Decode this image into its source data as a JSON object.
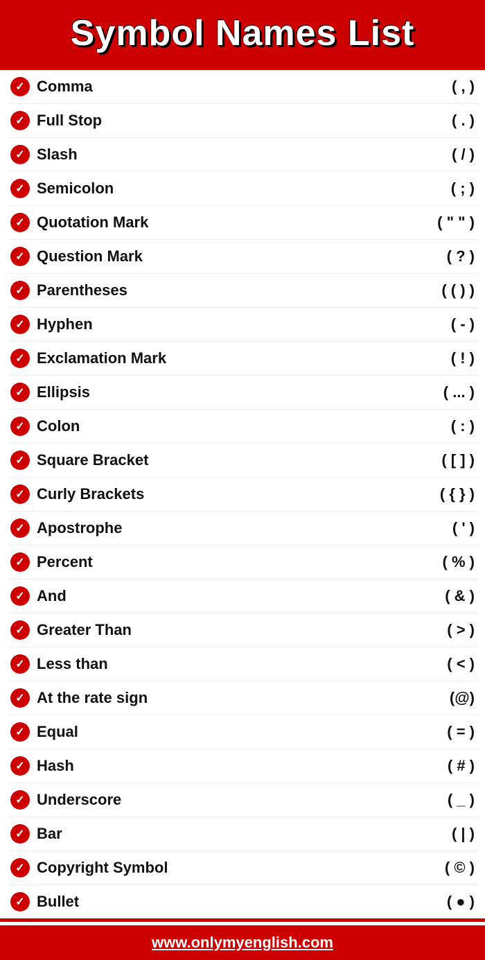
{
  "header": {
    "title": "Symbol Names List"
  },
  "symbols": [
    {
      "name": "Comma",
      "value": "( , )"
    },
    {
      "name": "Full Stop",
      "value": "( . )"
    },
    {
      "name": "Slash",
      "value": "( / )"
    },
    {
      "name": "Semicolon",
      "value": "( ; )"
    },
    {
      "name": "Quotation Mark",
      "value": "( \" \" )"
    },
    {
      "name": "Question Mark",
      "value": "( ? )"
    },
    {
      "name": "Parentheses",
      "value": "( ( ) )"
    },
    {
      "name": "Hyphen",
      "value": "( - )"
    },
    {
      "name": "Exclamation Mark",
      "value": "( ! )"
    },
    {
      "name": "Ellipsis",
      "value": "( ... )"
    },
    {
      "name": "Colon",
      "value": "( : )"
    },
    {
      "name": "Square Bracket",
      "value": "( [ ] )"
    },
    {
      "name": "Curly Brackets",
      "value": "( { } )"
    },
    {
      "name": "Apostrophe",
      "value": "( ' )"
    },
    {
      "name": "Percent",
      "value": "( % )"
    },
    {
      "name": "And",
      "value": "( & )"
    },
    {
      "name": "Greater Than",
      "value": "( > )"
    },
    {
      "name": "Less than",
      "value": "( < )"
    },
    {
      "name": "At the rate sign",
      "value": "(@)"
    },
    {
      "name": "Equal",
      "value": "( = )"
    },
    {
      "name": "Hash",
      "value": "( # )"
    },
    {
      "name": "Underscore",
      "value": "( _ )"
    },
    {
      "name": "Bar",
      "value": "( | )"
    },
    {
      "name": "Copyright Symbol",
      "value": "( © )"
    },
    {
      "name": "Bullet",
      "value": "( ● )"
    }
  ],
  "footer": {
    "url": "www.onlymyenglish.com"
  }
}
